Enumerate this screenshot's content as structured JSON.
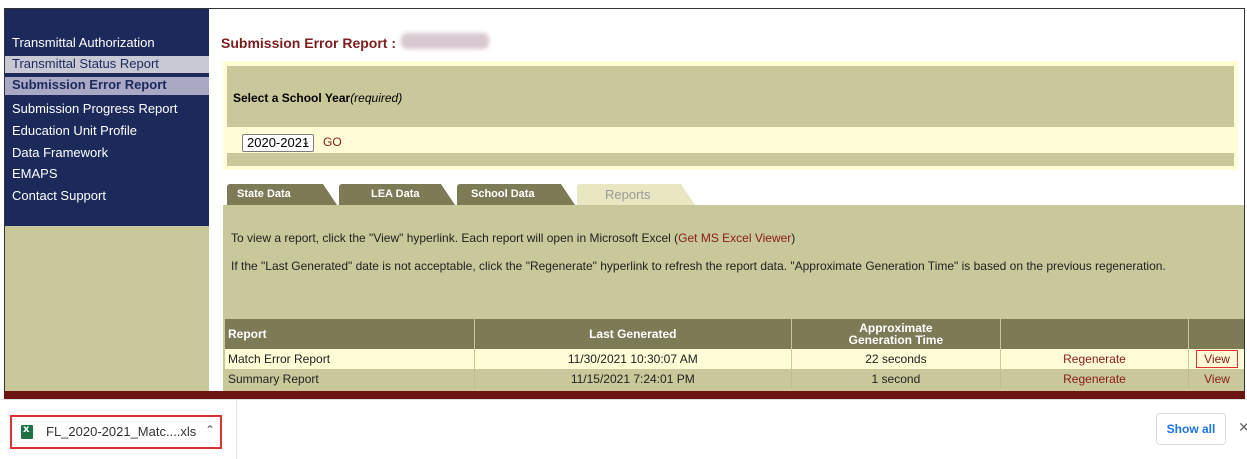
{
  "sidebar": {
    "items": [
      {
        "label": "Transmittal Authorization"
      },
      {
        "label": "Transmittal Status Report"
      },
      {
        "label": "Submission Error Report"
      },
      {
        "label": "Submission Progress Report"
      },
      {
        "label": "Education Unit Profile"
      },
      {
        "label": "Data Framework"
      },
      {
        "label": "EMAPS"
      },
      {
        "label": "Contact Support"
      }
    ]
  },
  "main": {
    "title": "Submission Error Report :",
    "year_label": "Select a School Year",
    "year_required": "(required)",
    "year_value": "2020-2021",
    "go_label": "GO",
    "tabs": [
      {
        "label": "State Data"
      },
      {
        "label": "LEA Data"
      },
      {
        "label": "School Data"
      },
      {
        "label": "Reports"
      }
    ],
    "info_line1": "To view a report, click the \"View\" hyperlink. Each report will open in Microsoft Excel (",
    "info_link": "Get MS Excel Viewer",
    "info_line1_end": ")",
    "info_line2": "If the \"Last Generated\" date is not acceptable, click the \"Regenerate\" hyperlink to refresh the report data. \"Approximate Generation Time\" is based on the previous regeneration.",
    "table": {
      "headers": {
        "report": "Report",
        "last_generated": "Last Generated",
        "approx_line1": "Approximate",
        "approx_line2": "Generation Time"
      },
      "rows": [
        {
          "report": "Match Error Report",
          "last_generated": "11/30/2021 10:30:07 AM",
          "gen_time": "22 seconds",
          "regen": "Regenerate",
          "view": "View"
        },
        {
          "report": "Summary Report",
          "last_generated": "11/15/2021 7:24:01 PM",
          "gen_time": "1 second",
          "regen": "Regenerate",
          "view": "View"
        }
      ]
    }
  },
  "download": {
    "filename": "FL_2020-2021_Matc....xls",
    "show_all": "Show all"
  }
}
